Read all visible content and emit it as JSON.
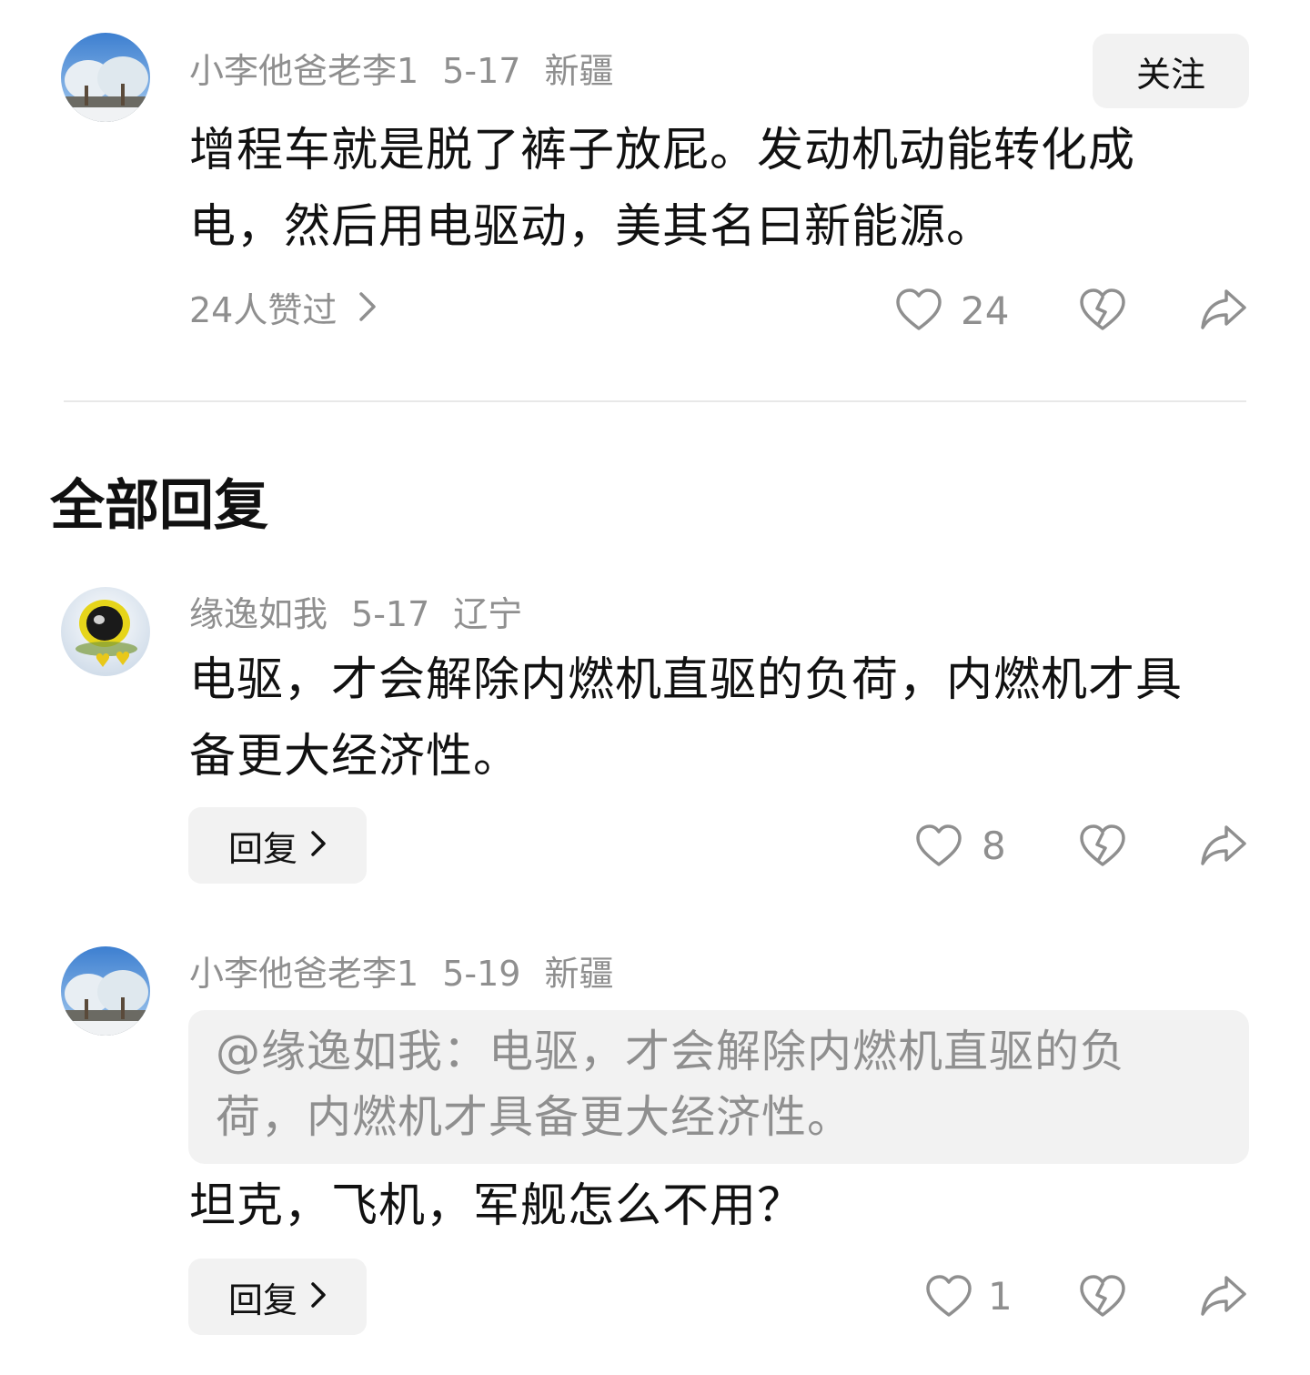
{
  "main_comment": {
    "username": "小李他爸老李1",
    "date": "5-17",
    "location": "新疆",
    "follow_label": "关注",
    "text": "增程车就是脱了裤子放屁。发动机动能转化成电，然后用电驱动，美其名曰新能源。",
    "likers_text": "24人赞过",
    "like_count": "24"
  },
  "section_title": "全部回复",
  "replies": [
    {
      "username": "缘逸如我",
      "date": "5-17",
      "location": "辽宁",
      "text": "电驱，才会解除内燃机直驱的负荷，内燃机才具备更大经济性。",
      "reply_label": "回复",
      "like_count": "8"
    },
    {
      "username": "小李他爸老李1",
      "date": "5-19",
      "location": "新疆",
      "quote": "@缘逸如我：电驱，才会解除内燃机直驱的负荷，内燃机才具备更大经济性。",
      "text": "坦克，飞机，军舰怎么不用？",
      "reply_label": "回复",
      "like_count": "1"
    }
  ],
  "icons": {
    "like": "heart-outline-icon",
    "dislike": "broken-heart-icon",
    "share": "share-arrow-icon",
    "chevron": "chevron-right-icon"
  }
}
